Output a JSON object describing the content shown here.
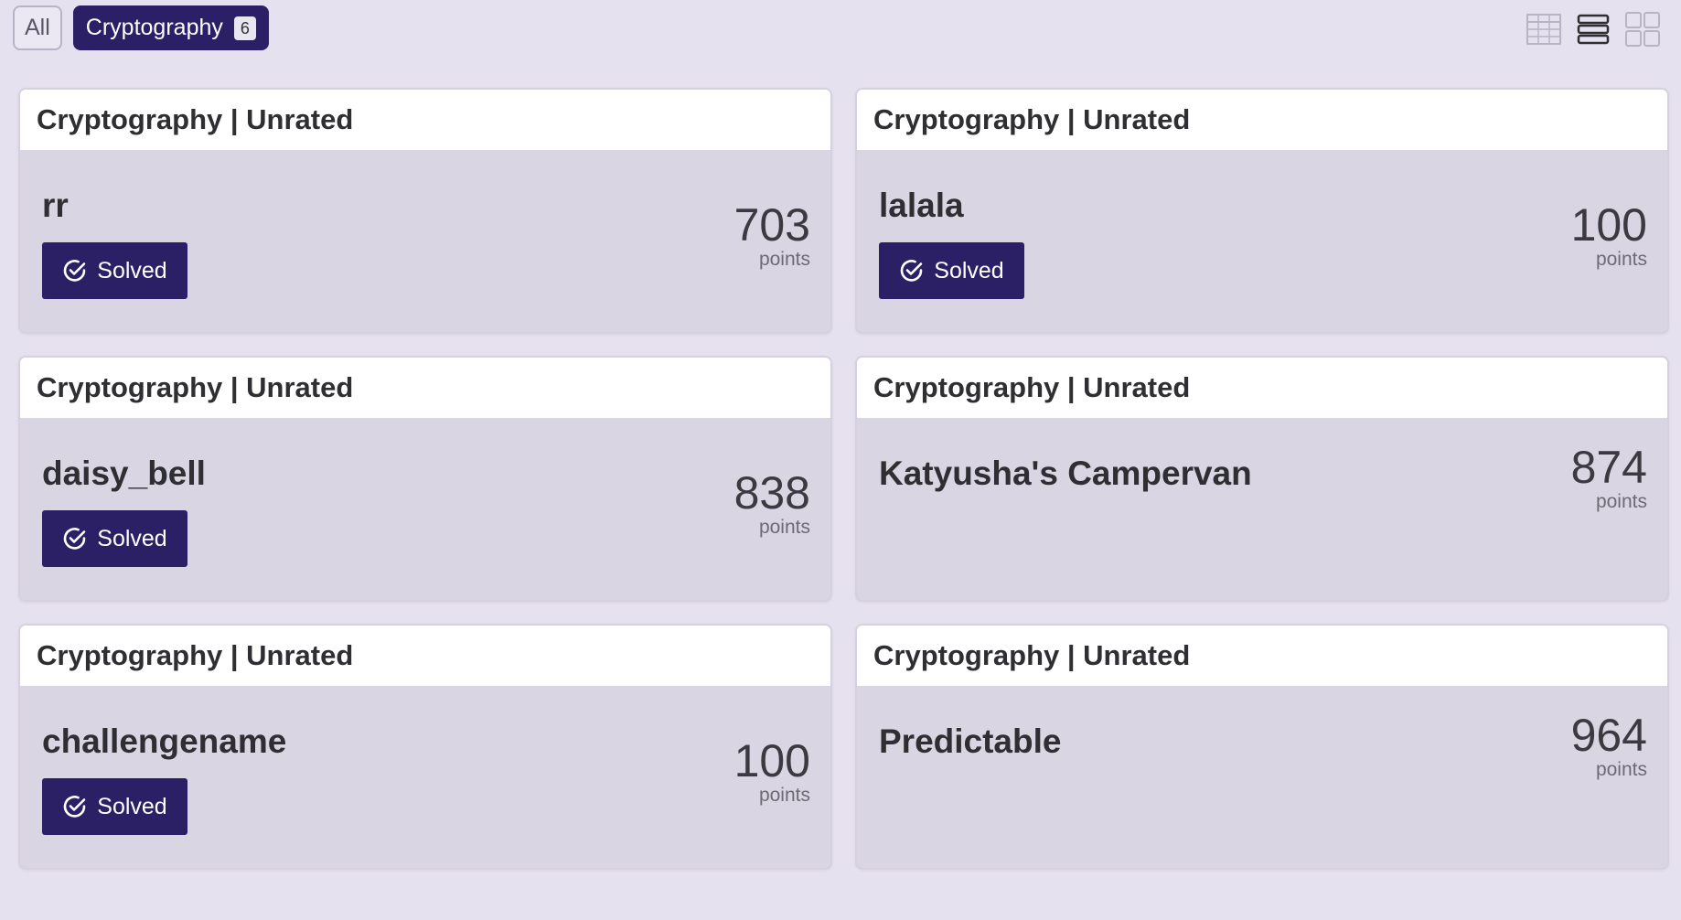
{
  "filters": {
    "all_label": "All",
    "category_label": "Cryptography",
    "category_count": "6"
  },
  "view_toggles": [
    {
      "icon": "table-view-icon"
    },
    {
      "icon": "list-view-icon"
    },
    {
      "icon": "grid-view-icon"
    }
  ],
  "challenges": [
    {
      "header": "Cryptography | Unrated",
      "name": "rr",
      "points": "703",
      "points_label": "points",
      "solved": true,
      "solved_label": "Solved"
    },
    {
      "header": "Cryptography | Unrated",
      "name": "lalala",
      "points": "100",
      "points_label": "points",
      "solved": true,
      "solved_label": "Solved"
    },
    {
      "header": "Cryptography | Unrated",
      "name": "daisy_bell",
      "points": "838",
      "points_label": "points",
      "solved": true,
      "solved_label": "Solved"
    },
    {
      "header": "Cryptography | Unrated",
      "name": "Katyusha's Campervan",
      "points": "874",
      "points_label": "points",
      "solved": false,
      "solved_label": ""
    },
    {
      "header": "Cryptography | Unrated",
      "name": "challengename",
      "points": "100",
      "points_label": "points",
      "solved": true,
      "solved_label": "Solved"
    },
    {
      "header": "Cryptography | Unrated",
      "name": "Predictable",
      "points": "964",
      "points_label": "points",
      "solved": false,
      "solved_label": ""
    }
  ],
  "colors": {
    "background": "#e6e1ef",
    "accent": "#2b1f66",
    "card_body": "#d9d5e2",
    "card_header": "#ffffff"
  }
}
